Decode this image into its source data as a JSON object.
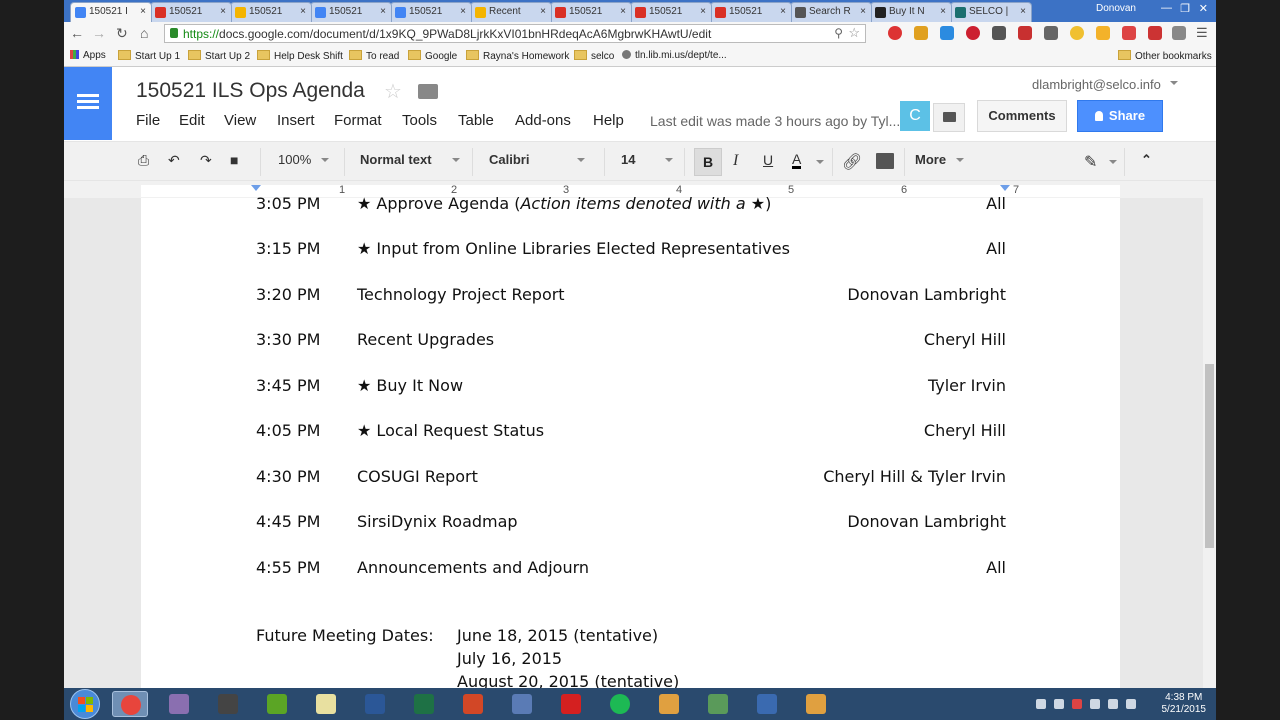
{
  "browser": {
    "tabs": [
      {
        "label": "150521 I",
        "color": "#4285f4",
        "active": true
      },
      {
        "label": "150521",
        "color": "#d93025"
      },
      {
        "label": "150521",
        "color": "#f4b400"
      },
      {
        "label": "150521",
        "color": "#4285f4"
      },
      {
        "label": "150521",
        "color": "#4285f4"
      },
      {
        "label": "Recent",
        "color": "#f4b400"
      },
      {
        "label": "150521",
        "color": "#d93025"
      },
      {
        "label": "150521",
        "color": "#d93025"
      },
      {
        "label": "150521",
        "color": "#d93025"
      },
      {
        "label": "Search R",
        "color": "#555555"
      },
      {
        "label": "Buy It N",
        "color": "#222222"
      },
      {
        "label": "SELCO |",
        "color": "#1b6f6f"
      }
    ],
    "window_user": "Donovan",
    "url_https": "https://",
    "url_rest": "docs.google.com/document/d/1x9KQ_9PWaD8LjrkKxVI01bnHRdeqAcA6MgbrwKHAwtU/edit",
    "bookmarks": [
      "Apps",
      "Start Up 1",
      "Start Up 2",
      "Help Desk Shift",
      "To read",
      "Google",
      "Rayna's Homework",
      "selco",
      "tln.lib.mi.us/dept/te...",
      "Other bookmarks"
    ]
  },
  "docs": {
    "title": "150521 ILS Ops Agenda",
    "menu": [
      "File",
      "Edit",
      "View",
      "Insert",
      "Format",
      "Tools",
      "Table",
      "Add-ons",
      "Help"
    ],
    "last_edit": "Last edit was made 3 hours ago by Tyl...",
    "user_email": "dlambright@selco.info",
    "avatar_letter": "C",
    "comments_label": "Comments",
    "share_label": "Share",
    "toolbar": {
      "zoom": "100%",
      "style": "Normal text",
      "font": "Calibri",
      "size": "14",
      "bold": "B",
      "italic": "I",
      "underline": "U",
      "text_color": "A",
      "more": "More"
    },
    "ruler_numbers": [
      "1",
      "2",
      "3",
      "4",
      "5",
      "6",
      "7"
    ]
  },
  "agenda": [
    {
      "time": "3:05 PM",
      "item": "★ Approve Agenda (",
      "item_italic": "Action items denoted with a",
      "item_tail": " ★)",
      "who": "All"
    },
    {
      "time": "3:15 PM",
      "item": "★ Input from Online Libraries Elected Representatives",
      "who": "All"
    },
    {
      "time": "3:20 PM",
      "item": "Technology Project Report",
      "who": "Donovan Lambright"
    },
    {
      "time": "3:30 PM",
      "item": "Recent Upgrades",
      "who": "Cheryl Hill"
    },
    {
      "time": "3:45 PM",
      "item": "★  Buy It Now",
      "who": "Tyler Irvin"
    },
    {
      "time": "4:05 PM",
      "item": "★  Local Request Status",
      "who": "Cheryl Hill"
    },
    {
      "time": "4:30 PM",
      "item": "COSUGI Report",
      "who": "Cheryl Hill & Tyler Irvin"
    },
    {
      "time": "4:45 PM",
      "item": "SirsiDynix Roadmap",
      "who": "Donovan Lambright"
    },
    {
      "time": "4:55 PM",
      "item": "Announcements and Adjourn",
      "who": "All"
    }
  ],
  "future": {
    "label": "Future Meeting Dates:",
    "dates": [
      "June 18, 2015 (tentative)",
      "July 16, 2015",
      "August 20, 2015 (tentative)"
    ]
  },
  "taskbar": {
    "apps": [
      "chrome",
      "chat",
      "owl",
      "evernote",
      "notepad",
      "word",
      "excel",
      "powerpoint",
      "paint",
      "splat",
      "spotify",
      "flower",
      "network",
      "remote",
      "flower2"
    ],
    "clock_time": "4:38 PM",
    "clock_date": "5/21/2015"
  }
}
